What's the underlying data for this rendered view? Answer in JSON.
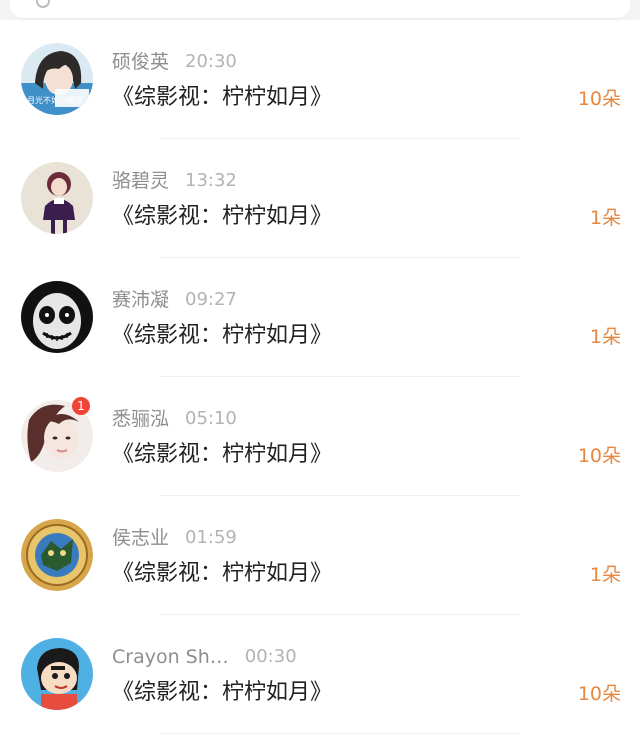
{
  "colors": {
    "name": "#8e8e8e",
    "time": "#b3b3b3",
    "gift_text": "#222222",
    "count": "#e8873f",
    "divider": "#f0f0f0"
  },
  "items": [
    {
      "name": "硕俊英",
      "time": "20:30",
      "gift": "《综影视：柠柠如月》",
      "count": "10朵",
      "avatar": "avatar-girl-wallpaper",
      "avatar_caption": "月光不如你耀眼"
    },
    {
      "name": "骆碧灵",
      "time": "13:32",
      "gift": "《综影视：柠柠如月》",
      "count": "1朵",
      "avatar": "avatar-girl-illustration"
    },
    {
      "name": "赛沛凝",
      "time": "09:27",
      "gift": "《综影视：柠柠如月》",
      "count": "1朵",
      "avatar": "avatar-skull-makeup"
    },
    {
      "name": "悉骊泓",
      "time": "05:10",
      "gift": "《综影视：柠柠如月》",
      "count": "10朵",
      "avatar": "avatar-woman-portrait",
      "badge": "1"
    },
    {
      "name": "侯志业",
      "time": "01:59",
      "gift": "《综影视：柠柠如月》",
      "count": "1朵",
      "avatar": "avatar-coin-emblem"
    },
    {
      "name": "Crayon Sh…",
      "time": "00:30",
      "gift": "《综影视：柠柠如月》",
      "count": "10朵",
      "avatar": "avatar-cartoon-boy"
    }
  ]
}
